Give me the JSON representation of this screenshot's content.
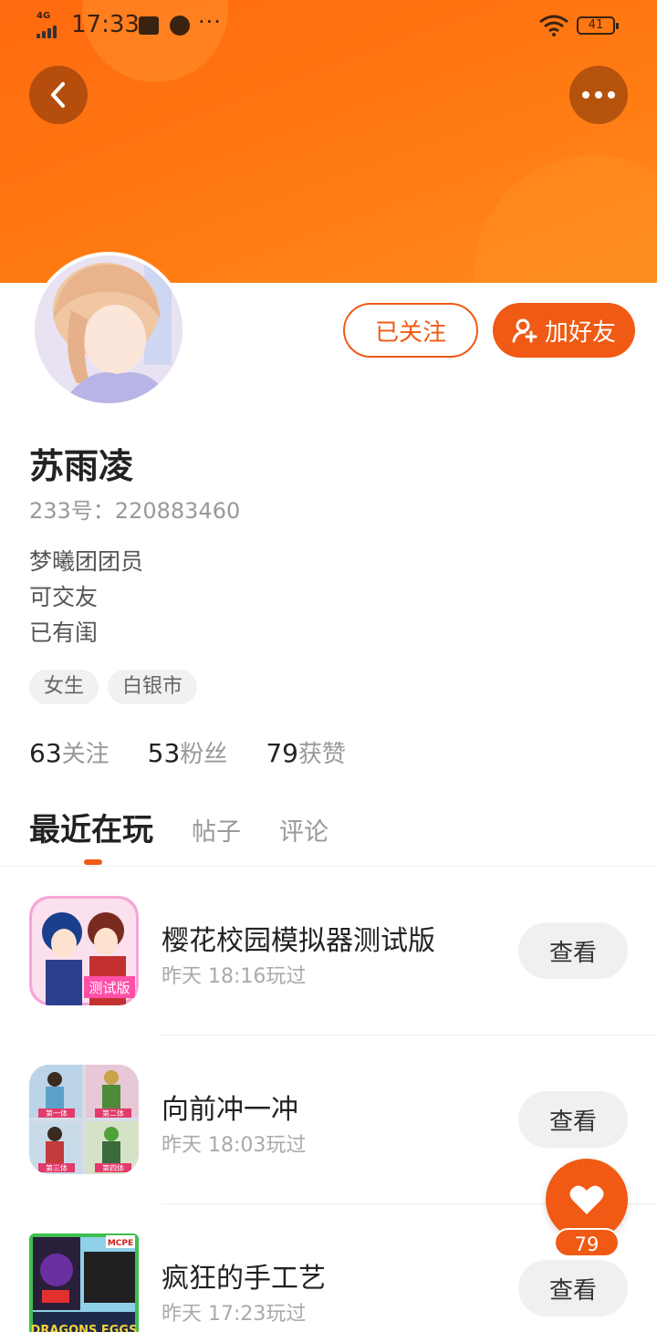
{
  "status_bar": {
    "network": "4G",
    "time": "17:33",
    "battery": "41"
  },
  "profile": {
    "name": "苏雨凌",
    "uid": "233号：220883460",
    "bio": [
      "梦曦团团员",
      "可交友",
      "已有闺"
    ],
    "tags": [
      "女生",
      "白银市"
    ]
  },
  "actions": {
    "follow_label": "已关注",
    "add_friend_label": "加好友"
  },
  "stats": [
    {
      "number": "63",
      "label": "关注"
    },
    {
      "number": "53",
      "label": "粉丝"
    },
    {
      "number": "79",
      "label": "获赞"
    }
  ],
  "tabs": [
    {
      "label": "最近在玩",
      "active": true
    },
    {
      "label": "帖子",
      "active": false
    },
    {
      "label": "评论",
      "active": false
    }
  ],
  "games": [
    {
      "title": "樱花校园模拟器测试版",
      "time": "昨天 18:16玩过",
      "button": "查看",
      "thumb_text": "测试版"
    },
    {
      "title": "向前冲一冲",
      "time": "昨天 18:03玩过",
      "button": "查看",
      "thumb_labels": [
        "第一体",
        "第二体",
        "第三体",
        "第四体"
      ]
    },
    {
      "title": "疯狂的手工艺",
      "time": "昨天 17:23玩过",
      "button": "查看",
      "thumb_badge": "MCPE",
      "thumb_text": "DRAGONS EGGS"
    }
  ],
  "like_fab": {
    "count": "79"
  },
  "colors": {
    "accent": "#f05a14",
    "header": "#ff7a12"
  }
}
